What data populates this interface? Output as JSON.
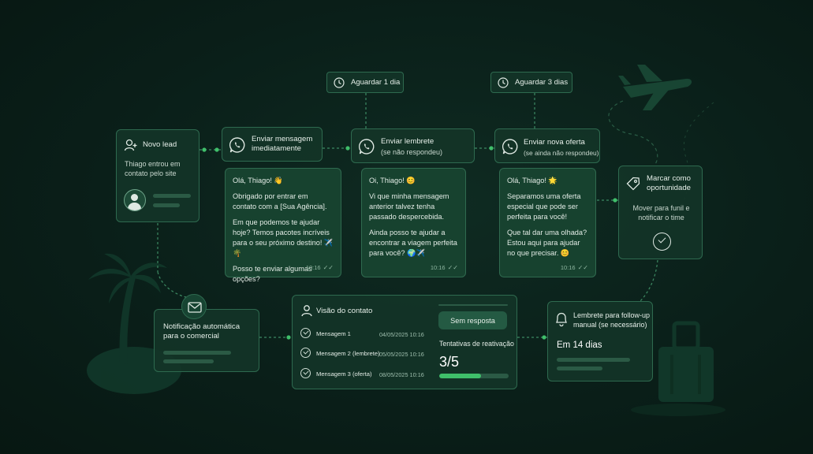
{
  "waits": {
    "wait1": "Aguardar 1 dia",
    "wait2": "Aguardar 3 dias"
  },
  "novo_lead": {
    "title": "Novo lead",
    "text": "Thiago entrou em contato pelo site"
  },
  "steps": {
    "step1_title": "Enviar mensagem imediatamente",
    "step2_title": "Enviar lembrete",
    "step2_sub": "(se não respondeu)",
    "step3_title": "Enviar nova oferta",
    "step3_sub": "(se ainda não respondeu)"
  },
  "chat1": {
    "greeting": "Olá, Thiago! 👋",
    "p1": "Obrigado por entrar em contato com a [Sua Agência].",
    "p2": "Em que podemos te ajudar hoje? Temos pacotes incríveis para o seu próximo destino! ✈️🌴",
    "p3": "Posso te enviar algumas opções?",
    "time": "10:16"
  },
  "chat2": {
    "greeting": "Oi, Thiago! 😊",
    "p1": "Vi que minha mensagem anterior talvez tenha passado despercebida.",
    "p2": "Ainda posso te ajudar a encontrar a viagem perfeita para você? 🌍✈️",
    "time": "10:16"
  },
  "chat3": {
    "greeting": "Olá, Thiago! 🌟",
    "p1": "Separamos uma oferta especial que pode ser perfeita para você!",
    "p2": "Que tal dar uma olhada? Estou aqui para ajudar no que precisar. 😊",
    "time": "10:16"
  },
  "oportunidade": {
    "title": "Marcar como oportunidade",
    "text": "Mover para funil e notificar o time"
  },
  "notificacao": {
    "text": "Notificação automática para o comercial"
  },
  "visao": {
    "title": "Visão do contato",
    "rows": [
      {
        "label": "Mensagem 1",
        "date": "04/05/2025 10:16"
      },
      {
        "label": "Mensagem 2 (lembrete)",
        "date": "05/05/2025 10:16"
      },
      {
        "label": "Mensagem 3 (oferta)",
        "date": "08/05/2025 10:16"
      }
    ],
    "status": "Sem resposta",
    "tentativas_label": "Tentativas de reativação",
    "tentativas_value": "3/5",
    "progress": 0.6
  },
  "lembrete": {
    "title": "Lembrete para follow-up manual (se necessário)",
    "value": "Em 14 dias"
  },
  "colors": {
    "accent": "#3fbf6a",
    "card_border": "#2e6a4f",
    "background": "#0b2019"
  }
}
